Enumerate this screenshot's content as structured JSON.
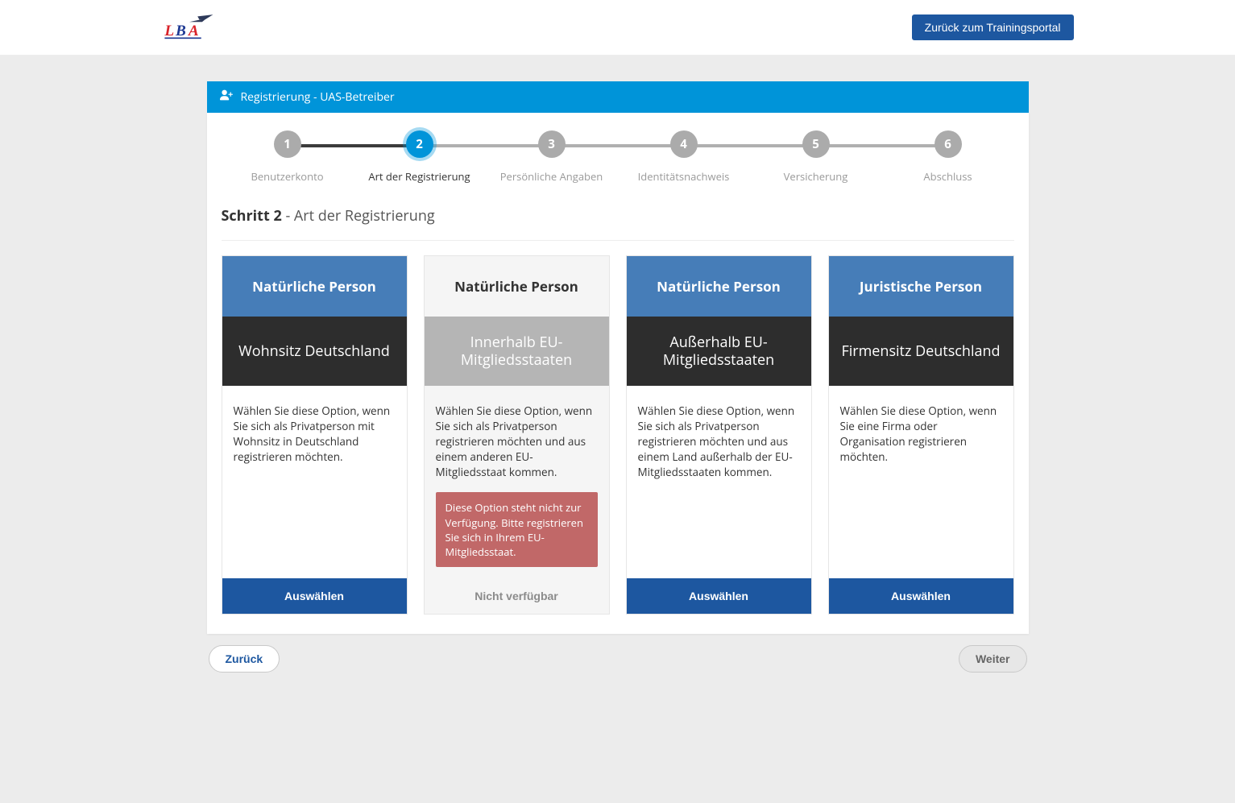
{
  "header": {
    "portal_button": "Zurück zum Trainingsportal"
  },
  "panel": {
    "title": "Registrierung - UAS-Betreiber"
  },
  "stepper": {
    "steps": [
      {
        "num": "1",
        "label": "Benutzerkonto"
      },
      {
        "num": "2",
        "label": "Art der Registrierung"
      },
      {
        "num": "3",
        "label": "Persönliche Angaben"
      },
      {
        "num": "4",
        "label": "Identitätsnachweis"
      },
      {
        "num": "5",
        "label": "Versicherung"
      },
      {
        "num": "6",
        "label": "Abschluss"
      }
    ],
    "active_index": 1
  },
  "step_title": {
    "bold": "Schritt 2",
    "light": " - Art der Registrierung"
  },
  "cards": [
    {
      "head": "Natürliche Person",
      "sub": "Wohnsitz Deutschland",
      "body": "Wählen Sie diese Option, wenn Sie sich als Privatperson mit Wohnsitz in Deutschland registrieren möchten.",
      "button": "Auswählen",
      "disabled": false,
      "alert": null
    },
    {
      "head": "Natürliche Person",
      "sub": "Innerhalb EU-Mitgliedsstaaten",
      "body": "Wählen Sie diese Option, wenn Sie sich als Privatperson registrieren möchten und aus einem anderen EU-Mitgliedsstaat kommen.",
      "button": "Nicht verfügbar",
      "disabled": true,
      "alert": "Diese Option steht nicht zur Verfügung. Bitte registrieren Sie sich in Ihrem EU-Mitgliedsstaat."
    },
    {
      "head": "Natürliche Person",
      "sub": "Außerhalb EU-Mitgliedsstaaten",
      "body": "Wählen Sie diese Option, wenn Sie sich als Privatperson registrieren möchten und aus einem Land außerhalb der EU-Mitgliedsstaaten kommen.",
      "button": "Auswählen",
      "disabled": false,
      "alert": null
    },
    {
      "head": "Juristische Person",
      "sub": "Firmensitz Deutschland",
      "body": "Wählen Sie diese Option, wenn Sie eine Firma oder Organisation registrieren möchten.",
      "button": "Auswählen",
      "disabled": false,
      "alert": null
    }
  ],
  "nav": {
    "back": "Zurück",
    "next": "Weiter"
  }
}
